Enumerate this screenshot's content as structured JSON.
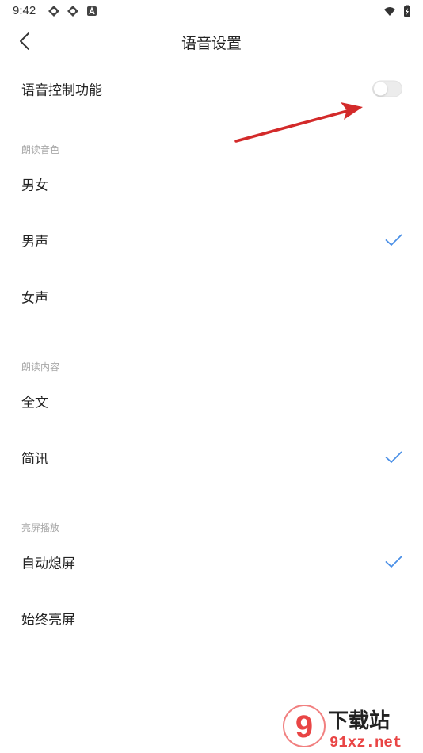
{
  "status_bar": {
    "time": "9:42"
  },
  "header": {
    "title": "语音设置"
  },
  "voice_control": {
    "label": "语音控制功能",
    "enabled": false
  },
  "sections": {
    "voice_tone": {
      "header": "朗读音色",
      "options": [
        {
          "label": "男女",
          "selected": false
        },
        {
          "label": "男声",
          "selected": true
        },
        {
          "label": "女声",
          "selected": false
        }
      ]
    },
    "read_content": {
      "header": "朗读内容",
      "options": [
        {
          "label": "全文",
          "selected": false
        },
        {
          "label": "简讯",
          "selected": true
        }
      ]
    },
    "screen_on_play": {
      "header": "亮屏播放",
      "options": [
        {
          "label": "自动熄屏",
          "selected": true
        },
        {
          "label": "始终亮屏",
          "selected": false
        }
      ]
    }
  },
  "colors": {
    "accent": "#4a8fe7",
    "annotation_arrow": "#d32a2a"
  },
  "watermark": {
    "logo_text": "9",
    "brand_text": "下载站",
    "url_text": "91xz.net"
  }
}
